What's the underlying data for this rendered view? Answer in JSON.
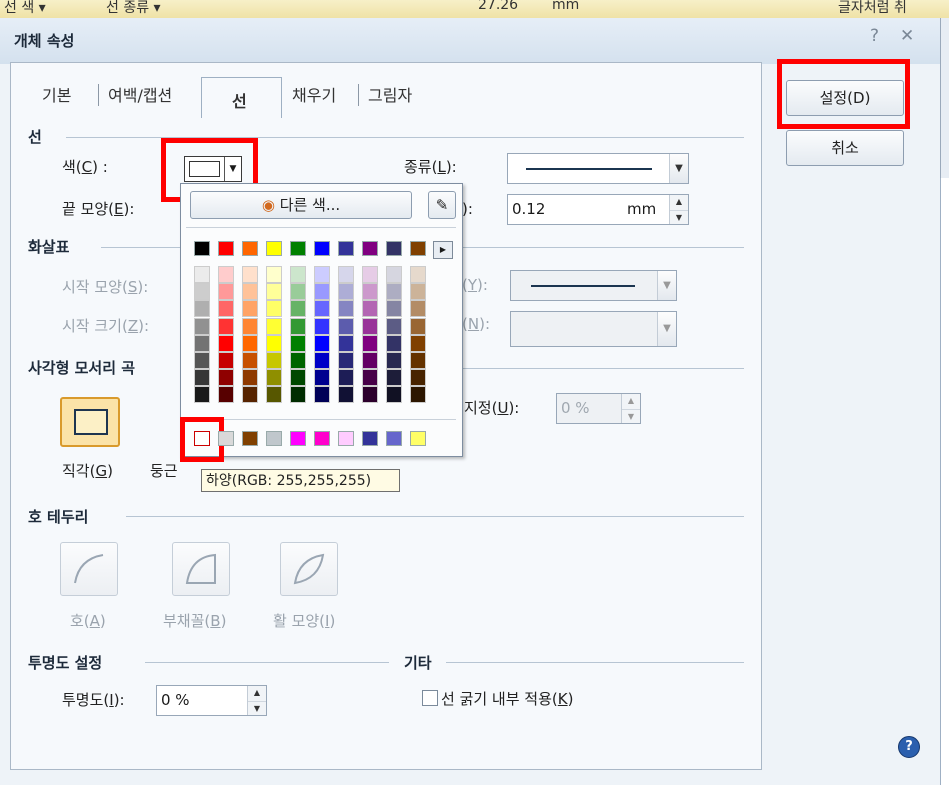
{
  "toolbar": {
    "line_color": "선 색 ▾",
    "line_kind": "선 종류 ▾",
    "size_value": "27.26",
    "size_unit": "mm",
    "wrap_text": "글자처럼 취"
  },
  "dialog": {
    "title": "개체 속성",
    "help_glyph": "?",
    "close_glyph": "✕"
  },
  "tabs": [
    "기본",
    "여백/캡션",
    "선",
    "채우기",
    "그림자"
  ],
  "buttons": {
    "ok": "설정(D)",
    "cancel": "취소"
  },
  "line": {
    "header": "선",
    "color_label": "색(C) :",
    "type_label": "종류(L):",
    "end_label": "끝 모양(E):",
    "thickness_label": "):",
    "thickness_value": "0.12",
    "thickness_unit": "mm"
  },
  "arrow": {
    "header": "화살표",
    "start_shape": "시작 모양(S):",
    "start_size": "시작 크기(Z):",
    "end_shape": "(Y):",
    "end_size": "(N):"
  },
  "corner": {
    "header": "사각형 모서리 곡",
    "custom_label": "지정(U):",
    "custom_value": "0 %",
    "rect_label": "직각(G)",
    "round_label": "둥근"
  },
  "arc": {
    "header": "호 테두리",
    "arc": "호(A)",
    "fan": "부채꼴(B)",
    "bow": "활 모양(I)"
  },
  "transparency": {
    "header": "투명도 설정",
    "label": "투명도(I):",
    "value": "0 %"
  },
  "misc": {
    "header": "기타",
    "inner_thickness": "선 굵기 내부 적용(K)"
  },
  "palette": {
    "other_color": "다른 색...",
    "base_colors": [
      "#000000",
      "#ff0000",
      "#ff6600",
      "#ffff00",
      "#008000",
      "#0000ff",
      "#333399",
      "#800080",
      "#333366",
      "#804000"
    ],
    "recent_colors": [
      "#ffffff",
      "#d9d9d9",
      "#804000",
      "#c0c7cc",
      "#ff00ff",
      "#ff00cc",
      "#ffccff",
      "#333399",
      "#6666cc",
      "#ffff66"
    ]
  },
  "tooltip": "하양(RGB: 255,255,255)"
}
